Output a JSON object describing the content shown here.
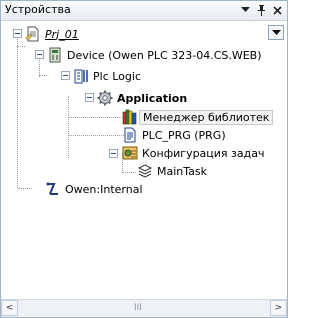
{
  "panel": {
    "title": "Устройства",
    "pin_symbol": "ᵽ",
    "close_symbol": "×"
  },
  "tree": {
    "project": "Prj_01",
    "device": "Device (Owen PLC 323-04.CS.WEB)",
    "plc_logic": "Plc Logic",
    "application": "Application",
    "library_manager": "Менеджер библиотек",
    "plc_prg": "PLC_PRG (PRG)",
    "task_config": "Конфигурация задач",
    "main_task": "MainTask",
    "owen_internal": "Owen:Internal"
  },
  "scrollbar": {
    "left_arrow": "<",
    "right_arrow": ">",
    "grip": "III"
  },
  "colors": {
    "accent": "#2b4a7a",
    "border": "#9fb4c9",
    "selection_bg": "#f3f3f3"
  }
}
